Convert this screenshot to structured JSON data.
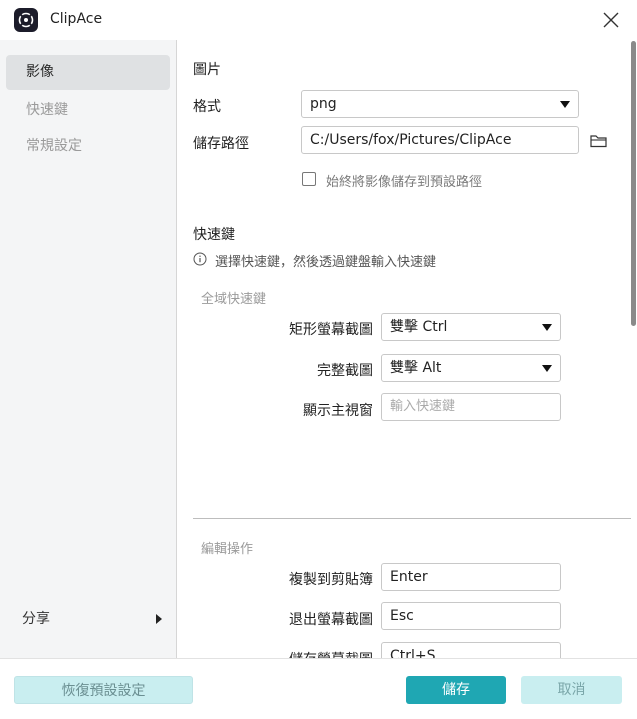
{
  "window": {
    "title": "ClipAce"
  },
  "sidebar": {
    "items": [
      {
        "label": "影像"
      },
      {
        "label": "快速鍵"
      },
      {
        "label": "常規設定"
      }
    ],
    "share_label": "分享"
  },
  "image_section": {
    "title": "圖片",
    "format_label": "格式",
    "format_value": "png",
    "path_label": "儲存路徑",
    "path_value": "C:/Users/fox/Pictures/ClipAce",
    "always_default_label": "始終將影像儲存到預設路徑",
    "always_default_checked": false
  },
  "hotkey_section": {
    "title": "快速鍵",
    "info_text": "選擇快速鍵，然後透過鍵盤輸入快速鍵",
    "global_title": "全域快速鍵",
    "rect_label": "矩形螢幕截圖",
    "rect_value": "雙擊 Ctrl",
    "full_label": "完整截圖",
    "full_value": "雙擊 Alt",
    "main_label": "顯示主視窗",
    "main_placeholder": "輸入快速鍵",
    "edit_title": "編輯操作",
    "copy_label": "複製到剪貼簿",
    "copy_value": "Enter",
    "exit_label": "退出螢幕截圖",
    "exit_value": "Esc",
    "save_label": "儲存螢幕截圖",
    "save_value": "Ctrl+S"
  },
  "footer": {
    "reset_label": "恢復預設設定",
    "save_label": "儲存",
    "cancel_label": "取消"
  },
  "colors": {
    "accent": "#1fa7b3",
    "accent_light": "#c9eef0",
    "sidebar_bg": "#f4f5f6"
  }
}
